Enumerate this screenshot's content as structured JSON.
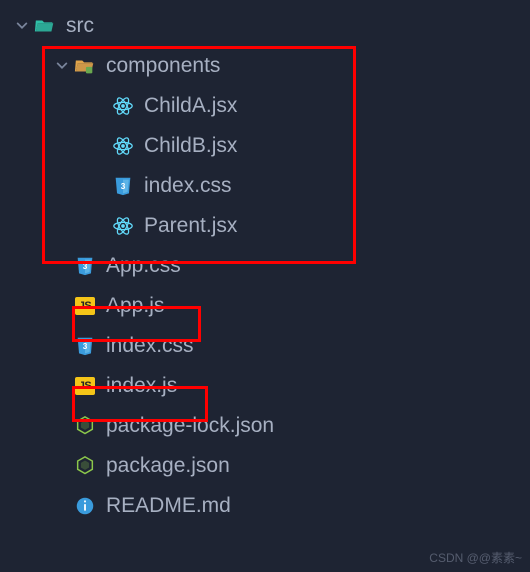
{
  "watermark": "CSDN @@素素~",
  "colors": {
    "folder_teal": "#2fbfa7",
    "folder_amber": "#e0a44a",
    "react": "#61dafb",
    "css": "#3a9bdc",
    "js_bg": "#f5c518",
    "node": "#8cc84b",
    "info": "#3a9bdc",
    "chev": "#7a859c"
  },
  "tree": [
    {
      "depth": 0,
      "label": "src",
      "icon": "folder-open-teal",
      "chevron": "down",
      "interactable": true,
      "name": "folder-src"
    },
    {
      "depth": 1,
      "label": "components",
      "icon": "folder-open-amber",
      "chevron": "down",
      "interactable": true,
      "name": "folder-components"
    },
    {
      "depth": 2,
      "label": "ChildA.jsx",
      "icon": "react",
      "chevron": "",
      "interactable": true,
      "name": "file-childa-jsx"
    },
    {
      "depth": 2,
      "label": "ChildB.jsx",
      "icon": "react",
      "chevron": "",
      "interactable": true,
      "name": "file-childb-jsx"
    },
    {
      "depth": 2,
      "label": "index.css",
      "icon": "css",
      "chevron": "",
      "interactable": true,
      "name": "file-components-index-css"
    },
    {
      "depth": 2,
      "label": "Parent.jsx",
      "icon": "react",
      "chevron": "",
      "interactable": true,
      "name": "file-parent-jsx"
    },
    {
      "depth": 1,
      "label": "App.css",
      "icon": "css",
      "chevron": "",
      "interactable": true,
      "name": "file-app-css"
    },
    {
      "depth": 1,
      "label": "App.js",
      "icon": "js",
      "chevron": "",
      "interactable": true,
      "name": "file-app-js"
    },
    {
      "depth": 1,
      "label": "index.css",
      "icon": "css",
      "chevron": "",
      "interactable": true,
      "name": "file-index-css"
    },
    {
      "depth": 1,
      "label": "index.js",
      "icon": "js",
      "chevron": "",
      "interactable": true,
      "name": "file-index-js"
    },
    {
      "depth": 1,
      "label": "package-lock.json",
      "icon": "node",
      "chevron": "",
      "interactable": true,
      "name": "file-package-lock-json"
    },
    {
      "depth": 1,
      "label": "package.json",
      "icon": "node",
      "chevron": "",
      "interactable": true,
      "name": "file-package-json"
    },
    {
      "depth": 1,
      "label": "README.md",
      "icon": "info",
      "chevron": "",
      "interactable": true,
      "name": "file-readme-md"
    }
  ],
  "js_badge_text": "JS"
}
